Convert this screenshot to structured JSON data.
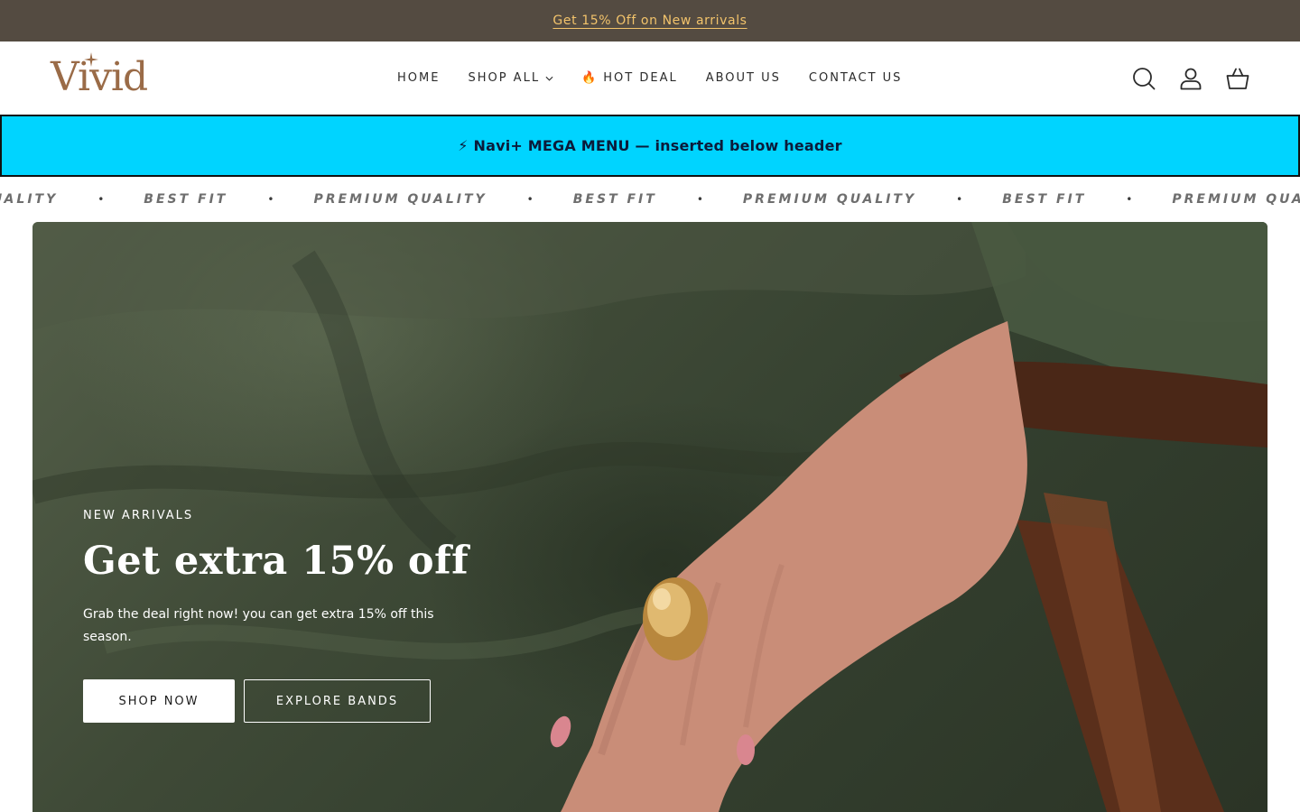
{
  "announcement": {
    "text": "Get 15% Off on New arrivals"
  },
  "header": {
    "logo_text": "Vivid",
    "nav": [
      {
        "label": "HOME",
        "has_dropdown": false,
        "icon": ""
      },
      {
        "label": "SHOP ALL",
        "has_dropdown": true,
        "icon": ""
      },
      {
        "label": "HOT DEAL",
        "has_dropdown": false,
        "icon": "🔥"
      },
      {
        "label": "ABOUT US",
        "has_dropdown": false,
        "icon": ""
      },
      {
        "label": "CONTACT US",
        "has_dropdown": false,
        "icon": ""
      }
    ],
    "icons": [
      "search-icon",
      "account-icon",
      "cart-icon"
    ]
  },
  "mega_banner": {
    "text": "⚡ Navi+ MEGA MENU — inserted below header"
  },
  "marquee": {
    "items": [
      "PREMIUM QUALITY",
      "BEST FIT",
      "PREMIUM QUALITY",
      "BEST FIT",
      "PREMIUM QUALITY",
      "BEST FIT",
      "PREMIUM QUALITY"
    ],
    "separator": "•"
  },
  "hero": {
    "eyebrow": "NEW ARRIVALS",
    "headline": "Get extra 15% off",
    "body": "Grab the deal right now! you can get extra 15% off this season.",
    "primary_cta": "SHOP NOW",
    "secondary_cta": "EXPLORE BANDS"
  },
  "colors": {
    "announcement_bg": "#544b41",
    "announcement_text": "#f2c36b",
    "logo": "#9a6b47",
    "mega_bg": "#00d4ff",
    "hero_green": "#3f4a37"
  }
}
